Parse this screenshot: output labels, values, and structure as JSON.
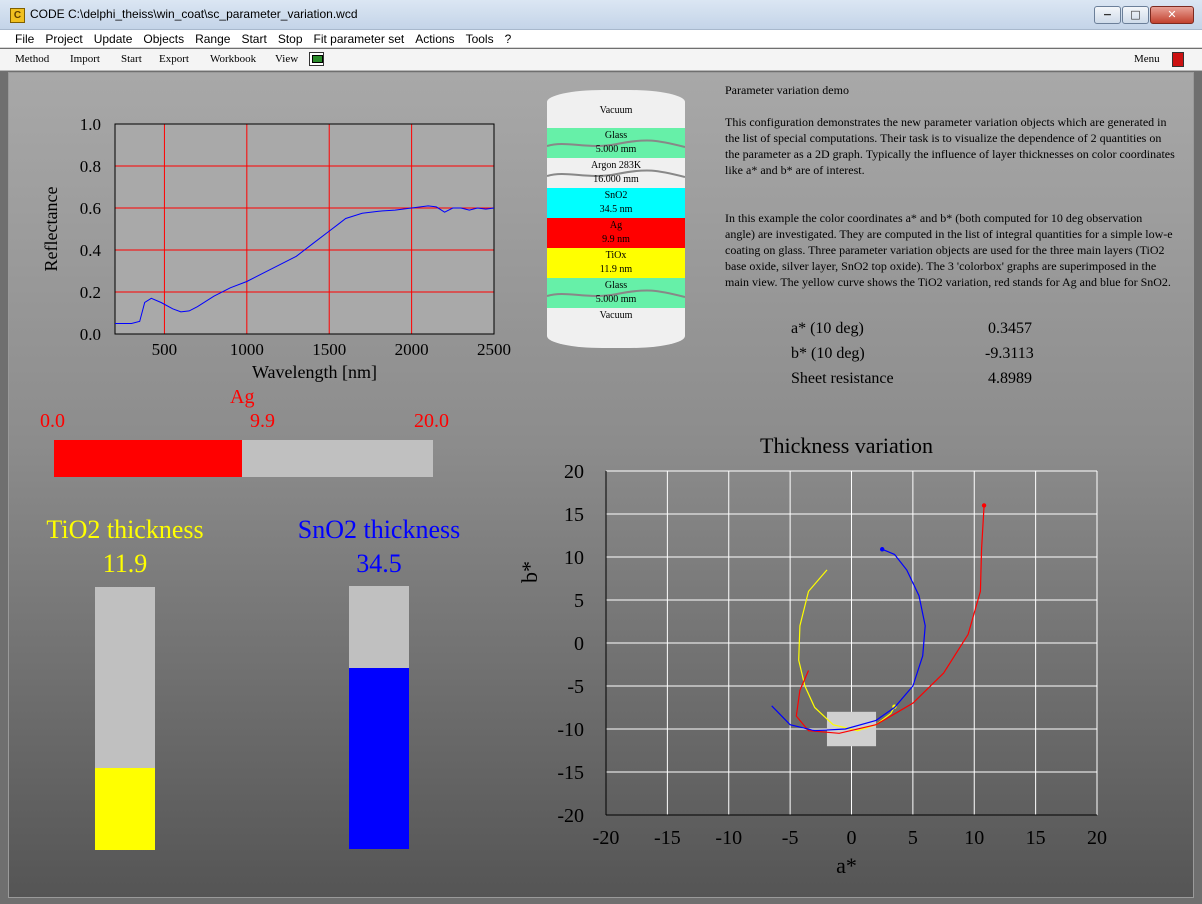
{
  "window": {
    "title": "CODE C:\\delphi_theiss\\win_coat\\sc_parameter_variation.wcd",
    "app_icon_glyph": "C",
    "minimize": "−",
    "maximize": "□",
    "close": "✕"
  },
  "menu": [
    "File",
    "Project",
    "Update",
    "Objects",
    "Range",
    "Start",
    "Stop",
    "Fit parameter set",
    "Actions",
    "Tools",
    "?"
  ],
  "toolbar": {
    "method": "Method",
    "import": "Import",
    "start": "Start",
    "export": "Export",
    "workbook": "Workbook",
    "view": "View",
    "menu": "Menu"
  },
  "reflectance_chart": {
    "type": "line",
    "ylabel": "Reflectance",
    "xlabel": "Wavelength [nm]",
    "xlim": [
      200,
      2500
    ],
    "ylim": [
      0,
      1
    ],
    "xticks": [
      500,
      1000,
      1500,
      2000,
      2500
    ],
    "yticks": [
      0.0,
      0.2,
      0.4,
      0.6,
      0.8,
      1.0
    ],
    "grid": true,
    "series_color": "#0000ff",
    "grid_color": "#ff0000",
    "x": [
      200,
      300,
      350,
      380,
      420,
      480,
      550,
      600,
      650,
      700,
      800,
      900,
      1000,
      1100,
      1200,
      1300,
      1400,
      1500,
      1550,
      1600,
      1700,
      1800,
      1900,
      2000,
      2100,
      2150,
      2180,
      2200,
      2250,
      2300,
      2350,
      2400,
      2450,
      2500
    ],
    "y": [
      0.05,
      0.05,
      0.06,
      0.15,
      0.17,
      0.15,
      0.12,
      0.105,
      0.11,
      0.13,
      0.18,
      0.22,
      0.25,
      0.29,
      0.33,
      0.37,
      0.43,
      0.49,
      0.52,
      0.55,
      0.575,
      0.585,
      0.59,
      0.6,
      0.61,
      0.605,
      0.59,
      0.58,
      0.6,
      0.6,
      0.59,
      0.6,
      0.595,
      0.6
    ]
  },
  "layers": [
    {
      "name": "Vacuum",
      "thickness": "",
      "color": "#f0f0f0",
      "wave": false
    },
    {
      "name": "Glass",
      "thickness": "5.000 mm",
      "color": "#66f0a8",
      "wave": true
    },
    {
      "name": "Argon 283K",
      "thickness": "16.000 mm",
      "color": "#f0f0f0",
      "wave": true
    },
    {
      "name": "SnO2",
      "thickness": "34.5 nm",
      "color": "#00ffff",
      "wave": false
    },
    {
      "name": "Ag",
      "thickness": "9.9 nm",
      "color": "#ff0000",
      "wave": false
    },
    {
      "name": "TiOx",
      "thickness": "11.9 nm",
      "color": "#ffff00",
      "wave": false
    },
    {
      "name": "Glass",
      "thickness": "5.000 mm",
      "color": "#66f0a8",
      "wave": true
    },
    {
      "name": "Vacuum",
      "thickness": "",
      "color": "#f0f0f0",
      "wave": false
    }
  ],
  "description": {
    "title": "Parameter variation demo",
    "p1": "This configuration demonstrates the new parameter variation objects which are generated in the list of special computations. Their task is to visualize the dependence of 2 quantities on the parameter as a 2D graph. Typically the influence of layer thicknesses on color coordinates like a* and b* are of interest.",
    "p2": "In this example the color coordinates a* and b* (both computed for 10 deg observation angle) are investigated. They are computed in the list of integral quantities for a simple low-e coating on glass. Three parameter variation objects are used for the three main layers (TiO2 base oxide, silver layer, SnO2 top oxide). The 3 'colorbox' graphs are superimposed in the main view. The yellow curve shows the TiO2 variation, red stands for Ag and blue for SnO2."
  },
  "results": [
    {
      "label": "a* (10 deg)",
      "value": "0.3457"
    },
    {
      "label": "b* (10 deg)",
      "value": "-9.3113"
    },
    {
      "label": "Sheet resistance",
      "value": "4.8989"
    }
  ],
  "ag_bar": {
    "label": "Ag",
    "min": "0.0",
    "max": "20.0",
    "value": "9.9",
    "fraction": 0.495,
    "fill_color": "#ff0000",
    "track_color": "#c0c0c0"
  },
  "tio2_bar": {
    "label": "TiO2 thickness",
    "value": "11.9",
    "fraction": 0.31,
    "color": "#ffff00",
    "track_color": "#c0c0c0"
  },
  "sno2_bar": {
    "label": "SnO2 thickness",
    "value": "34.5",
    "fraction": 0.69,
    "color": "#0000ff",
    "track_color": "#c0c0c0"
  },
  "thickness_chart": {
    "type": "line",
    "title": "Thickness variation",
    "xlabel": "a*",
    "ylabel": "b*",
    "xlim": [
      -20,
      20
    ],
    "ylim": [
      -20,
      20
    ],
    "ticks": [
      -20,
      -15,
      -10,
      -5,
      0,
      5,
      10,
      15,
      20
    ],
    "grid": true,
    "grid_color": "#ffffff",
    "current_box": {
      "x": [
        -2,
        2
      ],
      "y": [
        -12,
        -8
      ],
      "color": "#d0d0d0"
    },
    "series": [
      {
        "name": "TiO2",
        "color": "#ffff00",
        "x": [
          -2.0,
          -3.5,
          -4.2,
          -4.3,
          -3.8,
          -3.0,
          -1.5,
          0.5,
          2.0,
          3.2,
          3.5
        ],
        "y": [
          8.5,
          6.0,
          2.0,
          -2.0,
          -5.0,
          -7.5,
          -9.5,
          -10.2,
          -9.5,
          -8.2,
          -7.4
        ]
      },
      {
        "name": "Ag",
        "color": "#ff0000",
        "x": [
          -3.5,
          -4.2,
          -4.5,
          -3.5,
          -1.0,
          2.0,
          5.0,
          7.5,
          9.5,
          10.5,
          10.6,
          10.8
        ],
        "y": [
          -3.2,
          -5.5,
          -8.5,
          -10.2,
          -10.5,
          -9.5,
          -7.0,
          -3.5,
          1.0,
          6.0,
          11.0,
          16.0
        ]
      },
      {
        "name": "SnO2",
        "color": "#0000ff",
        "x": [
          -6.5,
          -5.0,
          -3.0,
          -0.5,
          2.0,
          3.5,
          5.0,
          5.8,
          6.0,
          5.5,
          4.5,
          3.5,
          2.5
        ],
        "y": [
          -7.3,
          -9.5,
          -10.2,
          -10.0,
          -9.0,
          -7.5,
          -5.0,
          -1.5,
          2.0,
          5.5,
          8.5,
          10.3,
          10.9
        ]
      }
    ]
  }
}
